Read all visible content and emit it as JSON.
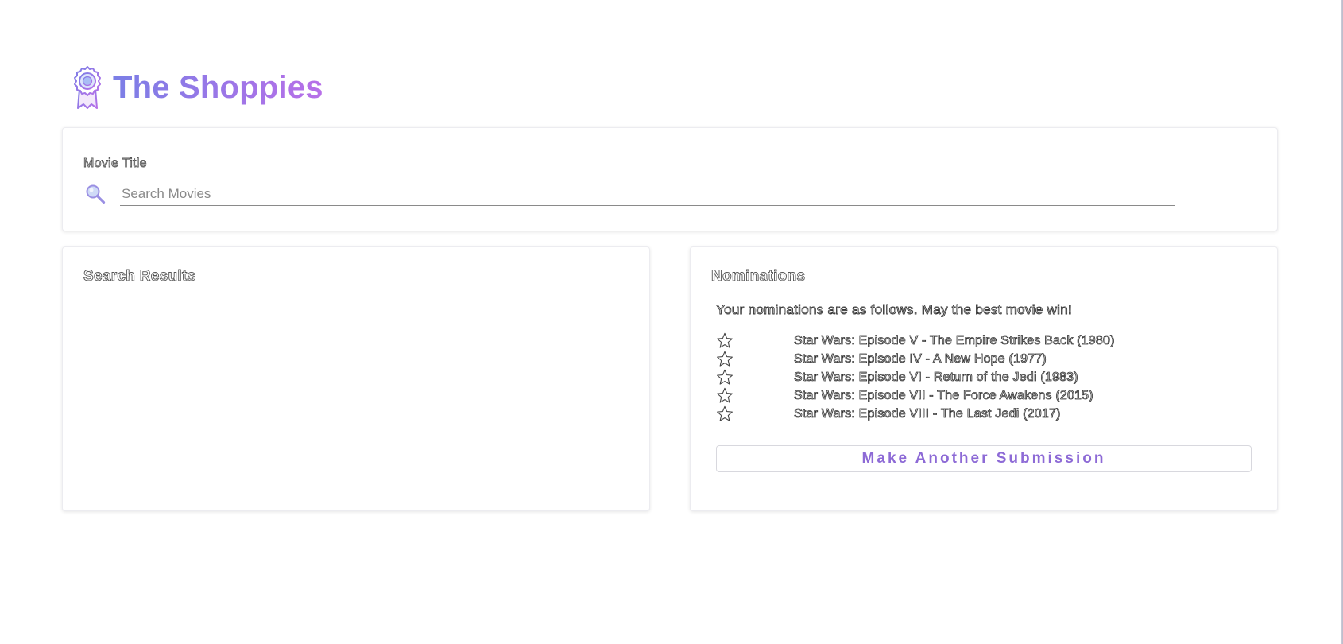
{
  "app": {
    "title": "The Shoppies",
    "logo_icon": "award-ribbon-icon",
    "accent_gradient": [
      "#7b7fe6",
      "#b86fe8"
    ]
  },
  "search": {
    "label": "Movie Title",
    "placeholder": "Search Movies",
    "value": "",
    "icon": "search-icon"
  },
  "results": {
    "heading": "Search Results",
    "items": []
  },
  "nominations": {
    "heading": "Nominations",
    "intro": "Your nominations are as follows. May the best movie win!",
    "items": [
      {
        "icon": "star-outline-icon",
        "title": "Star Wars: Episode V - The Empire Strikes Back (1980)"
      },
      {
        "icon": "star-outline-icon",
        "title": "Star Wars: Episode IV - A New Hope (1977)"
      },
      {
        "icon": "star-outline-icon",
        "title": "Star Wars: Episode VI - Return of the Jedi (1983)"
      },
      {
        "icon": "star-outline-icon",
        "title": "Star Wars: Episode VII - The Force Awakens (2015)"
      },
      {
        "icon": "star-outline-icon",
        "title": "Star Wars: Episode VIII - The Last Jedi (2017)"
      }
    ],
    "submit_label": "Make Another Submission",
    "submit_color": "#8d6ad6"
  }
}
